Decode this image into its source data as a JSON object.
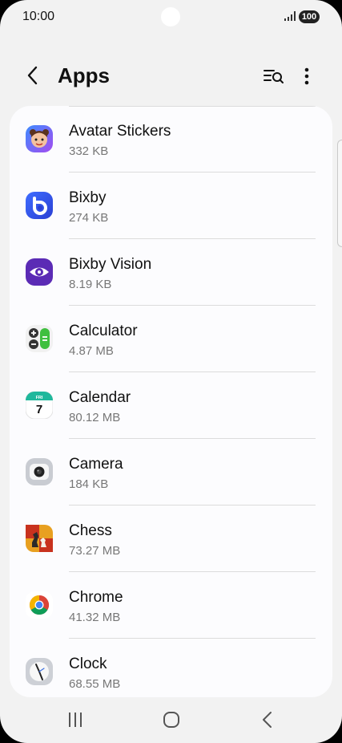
{
  "status_bar": {
    "time": "10:00",
    "battery": "100"
  },
  "header": {
    "title": "Apps"
  },
  "apps": [
    {
      "name": "Avatar Stickers",
      "size": "332 KB",
      "icon": "avatar-stickers-icon"
    },
    {
      "name": "Bixby",
      "size": "274 KB",
      "icon": "bixby-icon"
    },
    {
      "name": "Bixby Vision",
      "size": "8.19 KB",
      "icon": "bixby-vision-icon"
    },
    {
      "name": "Calculator",
      "size": "4.87 MB",
      "icon": "calculator-icon"
    },
    {
      "name": "Calendar",
      "size": "80.12 MB",
      "icon": "calendar-icon",
      "calendar_day": "FRI",
      "calendar_date": "7"
    },
    {
      "name": "Camera",
      "size": "184 KB",
      "icon": "camera-icon"
    },
    {
      "name": "Chess",
      "size": "73.27 MB",
      "icon": "chess-icon"
    },
    {
      "name": "Chrome",
      "size": "41.32 MB",
      "icon": "chrome-icon"
    },
    {
      "name": "Clock",
      "size": "68.55 MB",
      "icon": "clock-icon"
    }
  ],
  "colors": {
    "background": "#f2f2f2",
    "card": "#fcfcfe",
    "primary_text": "#111111",
    "secondary_text": "#777777"
  }
}
